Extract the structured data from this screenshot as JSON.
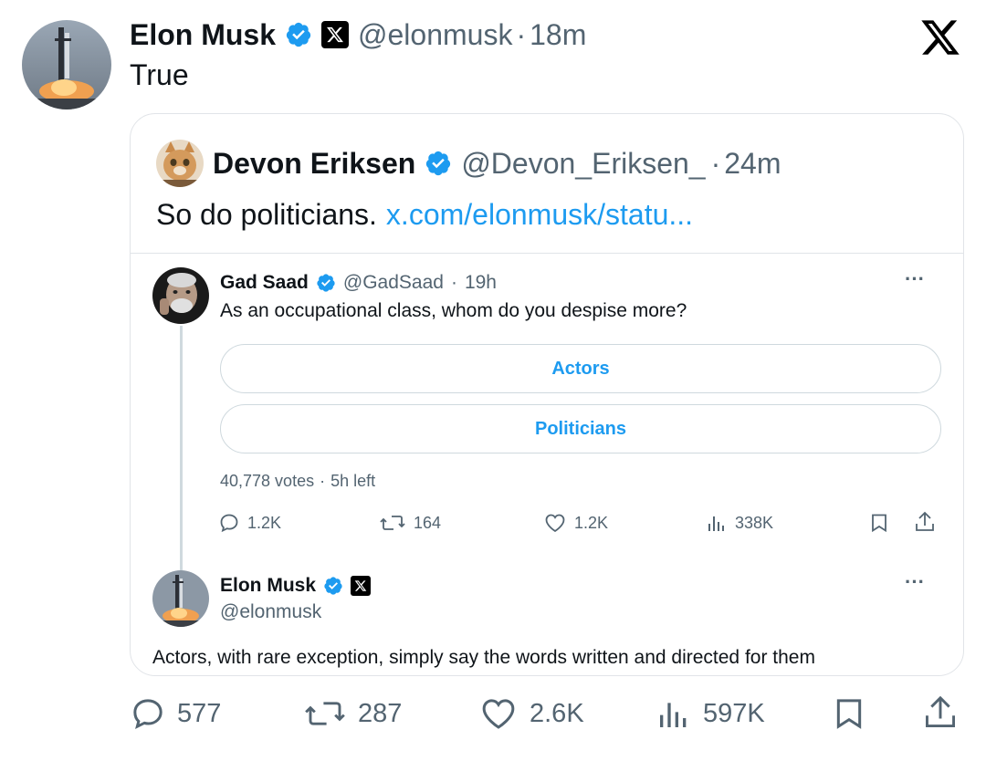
{
  "main_tweet": {
    "author_name": "Elon Musk",
    "handle": "@elonmusk",
    "separator": "·",
    "time": "18m",
    "text": "True",
    "actions": {
      "replies": "577",
      "reposts": "287",
      "likes": "2.6K",
      "views": "597K"
    }
  },
  "quote_tweet": {
    "author_name": "Devon Eriksen",
    "handle": "@Devon_Eriksen_",
    "separator": "·",
    "time": "24m",
    "text": "So do politicians.",
    "link": "x.com/elonmusk/statu..."
  },
  "embedded_tweet": {
    "author_name": "Gad Saad",
    "handle": "@GadSaad",
    "separator": "·",
    "time": "19h",
    "more": "···",
    "text": "As an occupational class, whom do you despise more?",
    "poll": {
      "options": [
        "Actors",
        "Politicians"
      ],
      "votes": "40,778 votes",
      "time_left": "5h left"
    },
    "actions": {
      "replies": "1.2K",
      "reposts": "164",
      "likes": "1.2K",
      "views": "338K"
    }
  },
  "reply_tweet": {
    "author_name": "Elon Musk",
    "handle": "@elonmusk",
    "more": "···",
    "text": "Actors, with rare exception, simply say the words written and directed for them"
  },
  "colors": {
    "accent": "#1d9bf0",
    "text": "#0f1419",
    "muted": "#536471",
    "border": "#e1e4e8"
  },
  "icons": [
    "verified-badge-icon",
    "x-logo-icon",
    "reply-icon",
    "repost-icon",
    "like-icon",
    "views-icon",
    "bookmark-icon",
    "share-icon",
    "more-icon"
  ]
}
